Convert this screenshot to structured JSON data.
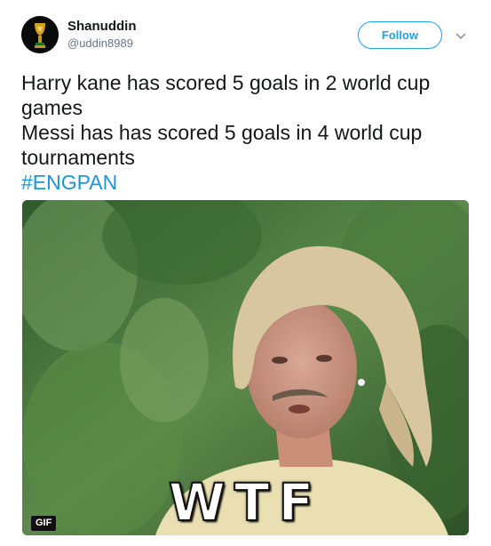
{
  "user": {
    "display_name": "Shanuddin",
    "handle": "@uddin8989"
  },
  "actions": {
    "follow_label": "Follow"
  },
  "tweet": {
    "lines": [
      "Harry kane has scored 5 goals in 2 world cup",
      "games",
      "Messi has has scored 5 goals in 4 world cup",
      "tournaments"
    ],
    "hashtag": "#ENGPAN"
  },
  "media": {
    "caption": "WTF",
    "badge": "GIF"
  },
  "colors": {
    "accent": "#1da1f2",
    "hashtag": "#1b95e0",
    "text": "#14171a",
    "muted": "#657786"
  },
  "icons": {
    "avatar": "world-cup-trophy-icon",
    "menu": "chevron-down-icon"
  }
}
